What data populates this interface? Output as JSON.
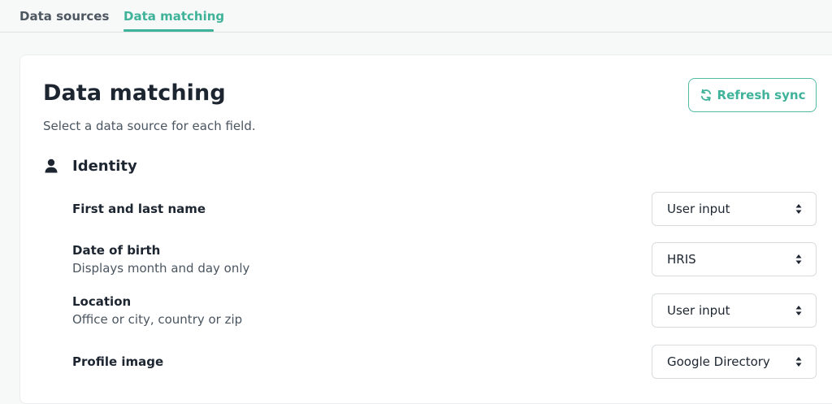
{
  "tabs": [
    {
      "label": "Data sources",
      "active": false
    },
    {
      "label": "Data matching",
      "active": true
    }
  ],
  "colors": {
    "accent": "#3fb39a",
    "text": "#1c2530",
    "muted": "#4a5560",
    "border": "#d8dcdf"
  },
  "header": {
    "title": "Data matching",
    "subtitle": "Select a data source for each field.",
    "refresh_label": "Refresh sync",
    "refresh_icon": "refresh-icon"
  },
  "section": {
    "title": "Identity",
    "icon": "user-icon"
  },
  "fields": [
    {
      "label": "First and last name",
      "description": "",
      "source": "User input"
    },
    {
      "label": "Date of birth",
      "description": "Displays month and day only",
      "source": "HRIS"
    },
    {
      "label": "Location",
      "description": "Office or city, country or zip",
      "source": "User input"
    },
    {
      "label": "Profile image",
      "description": "",
      "source": "Google Directory"
    }
  ]
}
